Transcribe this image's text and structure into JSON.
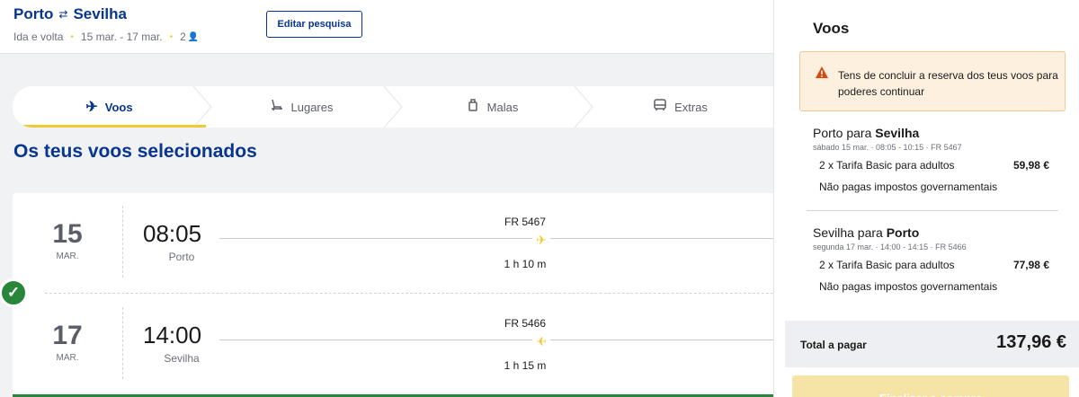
{
  "header": {
    "origin": "Porto",
    "destination": "Sevilha",
    "trip_type": "Ida e volta",
    "dates": "15 mar. - 17 mar.",
    "passengers": "2",
    "edit_label": "Editar pesquisa"
  },
  "steps": [
    {
      "label": "Voos",
      "icon": "plane-icon",
      "active": true
    },
    {
      "label": "Lugares",
      "icon": "seat-icon",
      "active": false
    },
    {
      "label": "Malas",
      "icon": "bag-icon",
      "active": false
    },
    {
      "label": "Extras",
      "icon": "bus-icon",
      "active": false
    }
  ],
  "main": {
    "section_title": "Os teus voos selecionados",
    "flights": [
      {
        "day": "15",
        "month": "MAR.",
        "time": "08:05",
        "city": "Porto",
        "flight_no": "FR 5467",
        "duration": "1 h 10 m"
      },
      {
        "day": "17",
        "month": "MAR.",
        "time": "14:00",
        "city": "Sevilha",
        "flight_no": "FR 5466",
        "duration": "1 h 15 m"
      }
    ]
  },
  "summary": {
    "title": "Voos",
    "warning": "Tens de concluir a reserva dos teus voos para poderes continuar",
    "legs": [
      {
        "from": "Porto para ",
        "to": "Sevilha",
        "details": "sábado 15 mar. · 08:05 - 10:15 · FR 5467",
        "fare": "2 x Tarifa Basic para adultos",
        "price": "59,98 €",
        "note": "Não pagas impostos governamentais"
      },
      {
        "from": "Sevilha para ",
        "to": "Porto",
        "details": "segunda 17 mar. · 14:00 - 14:15 · FR 5466",
        "fare": "2 x Tarifa Basic para adultos",
        "price": "77,98 €",
        "note": "Não pagas impostos governamentais"
      }
    ],
    "total_label": "Total a pagar",
    "total_value": "137,96 €",
    "buy_label": "Finalizar a compra"
  },
  "colors": {
    "brand_blue": "#073590",
    "accent_yellow": "#f1c933",
    "success_green": "#27863a",
    "warning_bg": "#fdf0df",
    "warning_icon": "#d9480f"
  }
}
